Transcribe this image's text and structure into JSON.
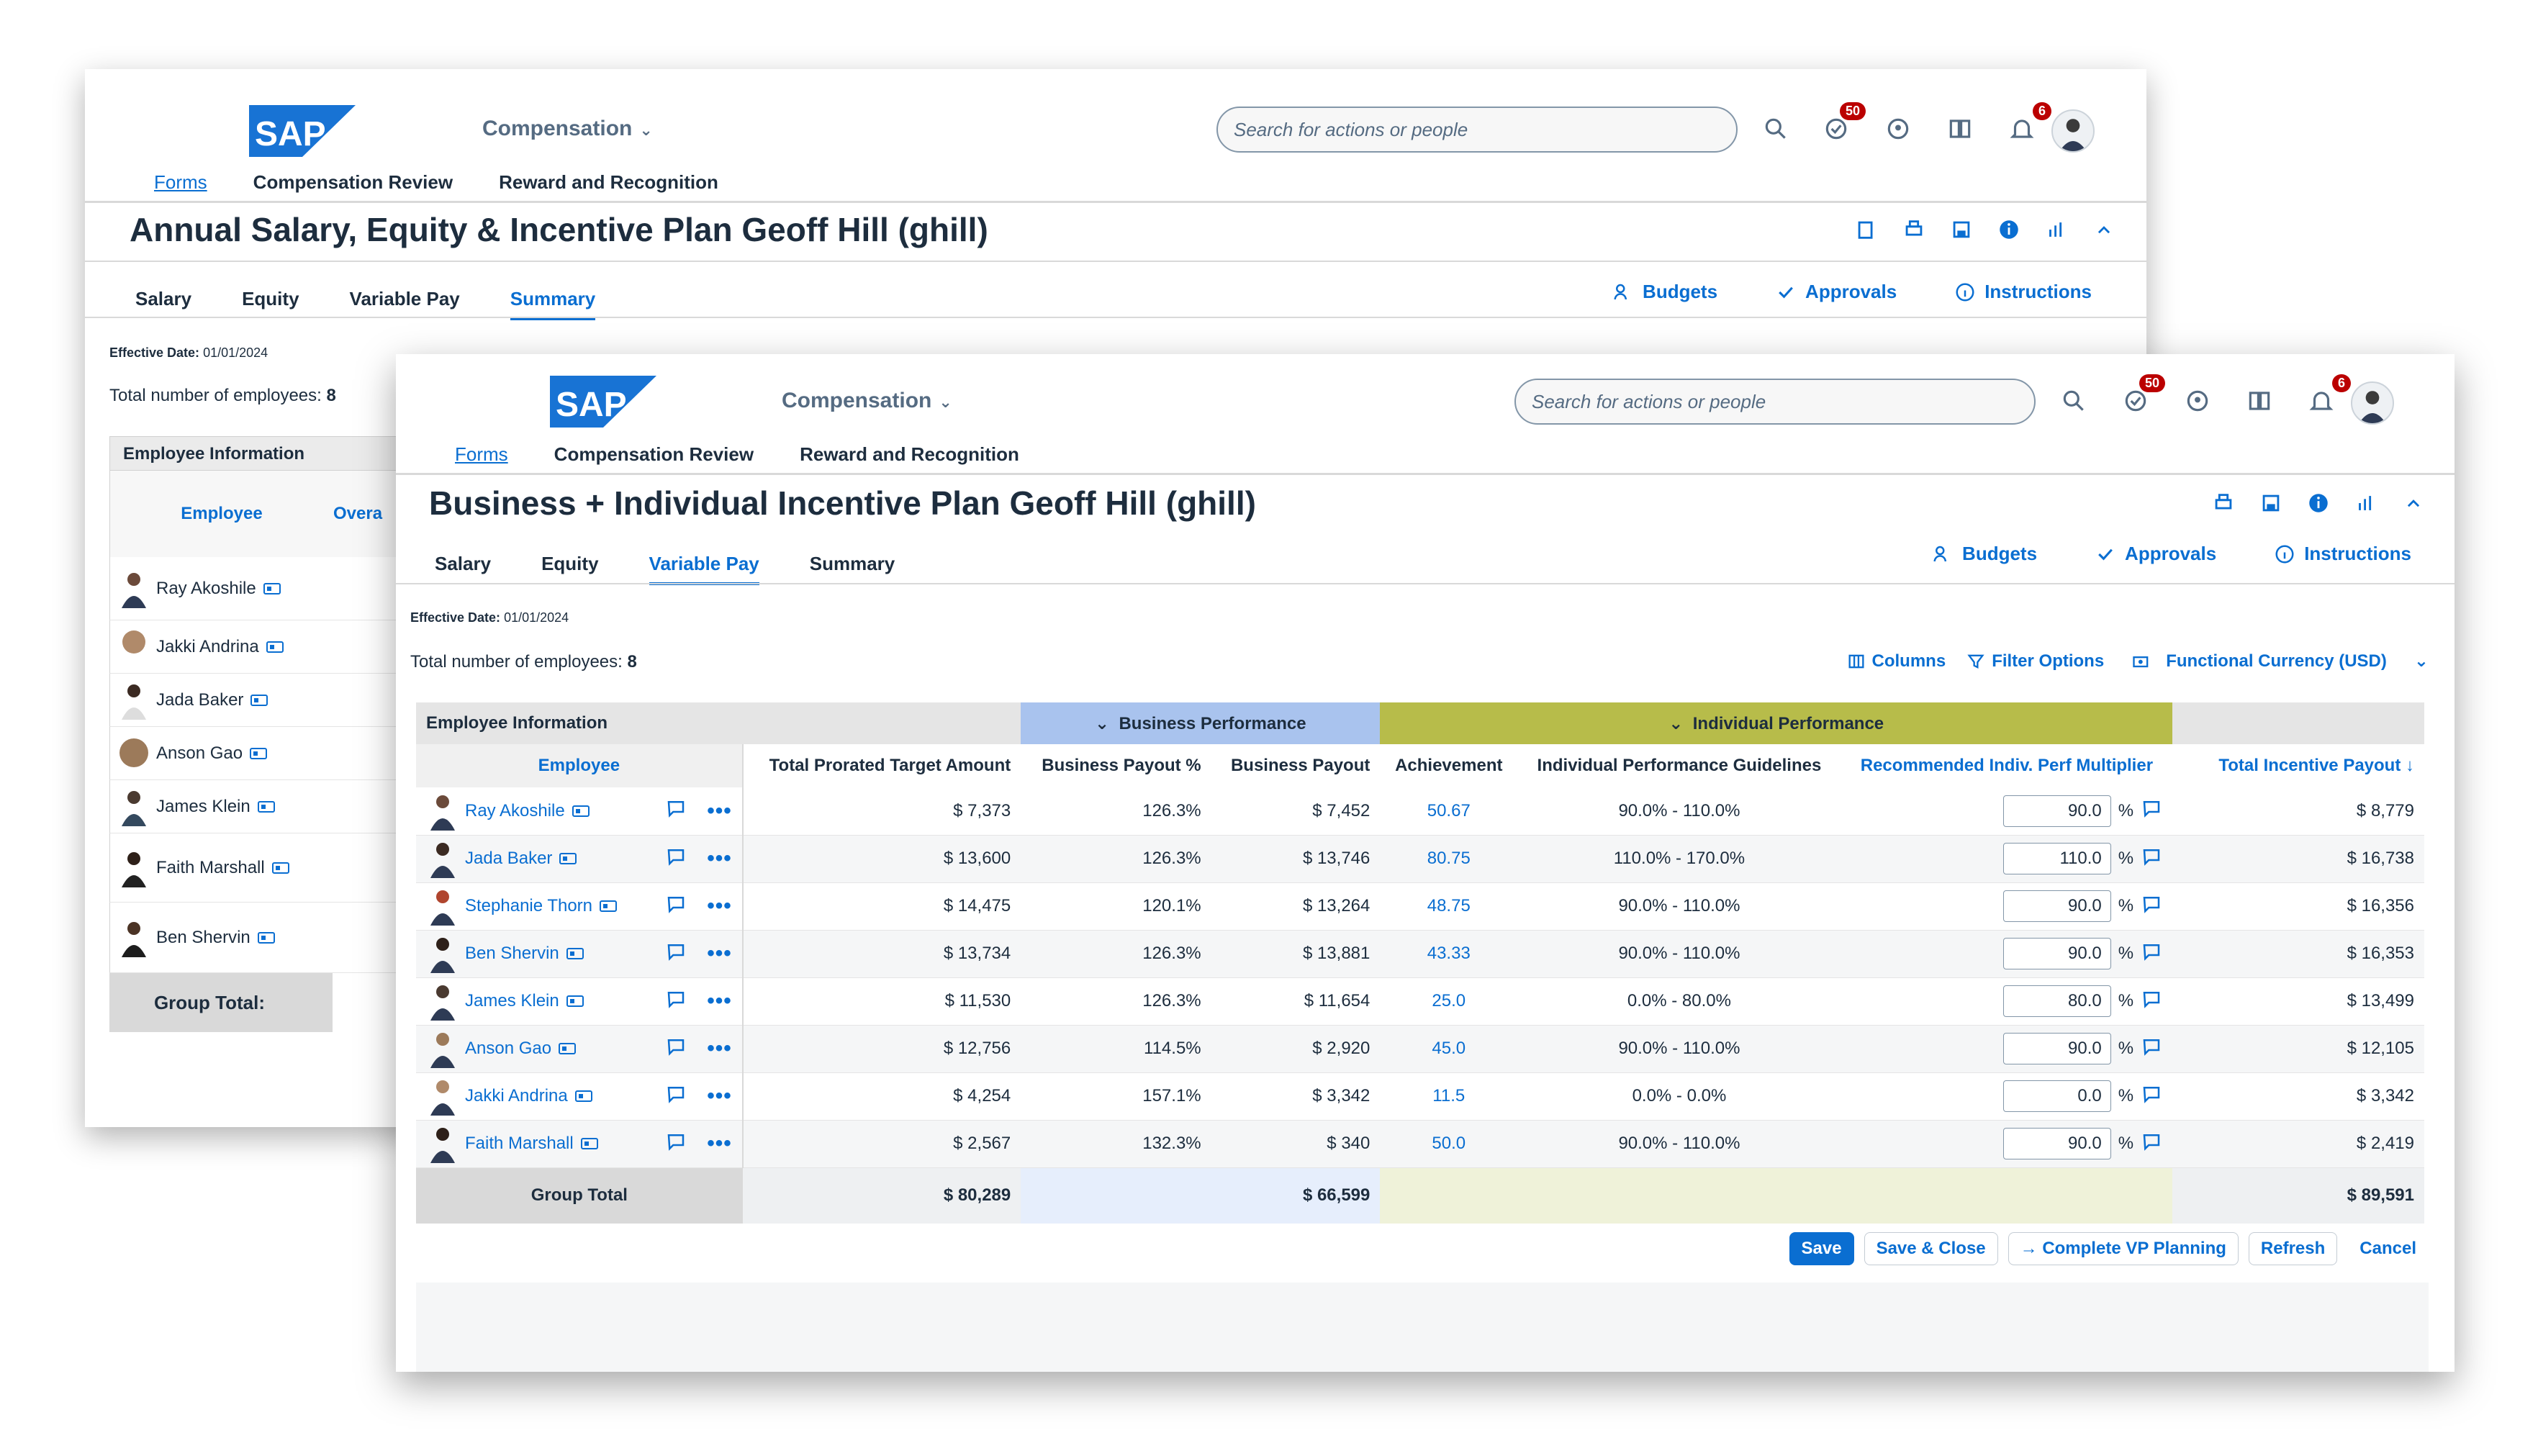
{
  "brand": {
    "logo_text": "SAP",
    "logo_color": "#1873d4"
  },
  "shell": {
    "app_title": "Compensation",
    "search_placeholder": "Search for actions or people",
    "todo_badge": "50",
    "notif_badge": "6",
    "subnav": {
      "forms": "Forms",
      "review": "Compensation Review",
      "reward": "Reward and Recognition"
    }
  },
  "back_form": {
    "title": "Annual Salary, Equity & Incentive Plan Geoff Hill (ghill)",
    "tabs": [
      "Salary",
      "Equity",
      "Variable Pay",
      "Summary"
    ],
    "active_tab": "Summary",
    "actions": {
      "budgets": "Budgets",
      "approvals": "Approvals",
      "instructions": "Instructions"
    },
    "effective_label": "Effective Date:",
    "effective_value": "01/01/2024",
    "count_label": "Total number of employees:",
    "count_value": "8",
    "table": {
      "group_header": "Employee Information",
      "col_employee": "Employee",
      "col_overall": "Overa",
      "rows": [
        "Ray Akoshile",
        "Jakki Andrina",
        "Jada Baker",
        "Anson Gao",
        "James Klein",
        "Faith Marshall",
        "Ben Shervin"
      ],
      "group_total": "Group Total:"
    }
  },
  "front_form": {
    "title": "Business + Individual Incentive Plan Geoff Hill (ghill)",
    "tabs": [
      "Salary",
      "Equity",
      "Variable Pay",
      "Summary"
    ],
    "active_tab": "Variable Pay",
    "actions": {
      "budgets": "Budgets",
      "approvals": "Approvals",
      "instructions": "Instructions"
    },
    "effective_label": "Effective Date:",
    "effective_value": "01/01/2024",
    "count_label": "Total number of employees:",
    "count_value": "8",
    "toolbar": {
      "columns": "Columns",
      "filter": "Filter Options",
      "currency": "Functional Currency (USD)"
    },
    "table": {
      "groups": {
        "employee_info": "Employee Information",
        "business": "Business Performance",
        "individual": "Individual Performance"
      },
      "headers": {
        "employee": "Employee",
        "target": "Total Prorated Target Amount",
        "bus_pct": "Business Payout %",
        "bus_payout": "Business Payout",
        "achievement": "Achievement",
        "guidelines": "Individual Performance Guidelines",
        "multiplier": "Recommended Indiv. Perf Multiplier",
        "total": "Total Incentive Payout"
      },
      "rows": [
        {
          "name": "Ray Akoshile",
          "target": "$ 7,373",
          "bus_pct": "126.3%",
          "bus_payout": "$ 7,452",
          "achievement": "50.67",
          "guideline": "90.0% - 110.0%",
          "multiplier": "90.0",
          "total": "$ 8,779"
        },
        {
          "name": "Jada Baker",
          "target": "$ 13,600",
          "bus_pct": "126.3%",
          "bus_payout": "$ 13,746",
          "achievement": "80.75",
          "guideline": "110.0% - 170.0%",
          "multiplier": "110.0",
          "total": "$ 16,738"
        },
        {
          "name": "Stephanie Thorn",
          "target": "$ 14,475",
          "bus_pct": "120.1%",
          "bus_payout": "$ 13,264",
          "achievement": "48.75",
          "guideline": "90.0% - 110.0%",
          "multiplier": "90.0",
          "total": "$ 16,356"
        },
        {
          "name": "Ben Shervin",
          "target": "$ 13,734",
          "bus_pct": "126.3%",
          "bus_payout": "$ 13,881",
          "achievement": "43.33",
          "guideline": "90.0% - 110.0%",
          "multiplier": "90.0",
          "total": "$ 16,353"
        },
        {
          "name": "James Klein",
          "target": "$ 11,530",
          "bus_pct": "126.3%",
          "bus_payout": "$ 11,654",
          "achievement": "25.0",
          "guideline": "0.0% - 80.0%",
          "multiplier": "80.0",
          "total": "$ 13,499"
        },
        {
          "name": "Anson Gao",
          "target": "$ 12,756",
          "bus_pct": "114.5%",
          "bus_payout": "$ 2,920",
          "achievement": "45.0",
          "guideline": "90.0% - 110.0%",
          "multiplier": "90.0",
          "total": "$ 12,105"
        },
        {
          "name": "Jakki Andrina",
          "target": "$ 4,254",
          "bus_pct": "157.1%",
          "bus_payout": "$ 3,342",
          "achievement": "11.5",
          "guideline": "0.0% - 0.0%",
          "multiplier": "0.0",
          "total": "$ 3,342"
        },
        {
          "name": "Faith Marshall",
          "target": "$ 2,567",
          "bus_pct": "132.3%",
          "bus_payout": "$ 340",
          "achievement": "50.0",
          "guideline": "90.0% - 110.0%",
          "multiplier": "90.0",
          "total": "$ 2,419"
        }
      ],
      "pct_sign": "%",
      "group_total": {
        "label": "Group Total",
        "target": "$ 80,289",
        "bus_payout": "$ 66,599",
        "total": "$ 89,591"
      }
    },
    "buttons": {
      "save": "Save",
      "save_close": "Save & Close",
      "complete": "Complete VP Planning",
      "refresh": "Refresh",
      "cancel": "Cancel"
    }
  },
  "colors": {
    "accent": "#0a6ed1",
    "business_header": "#a9c3ee",
    "individual_header": "#b7bc4a",
    "badge": "#bb0000"
  }
}
